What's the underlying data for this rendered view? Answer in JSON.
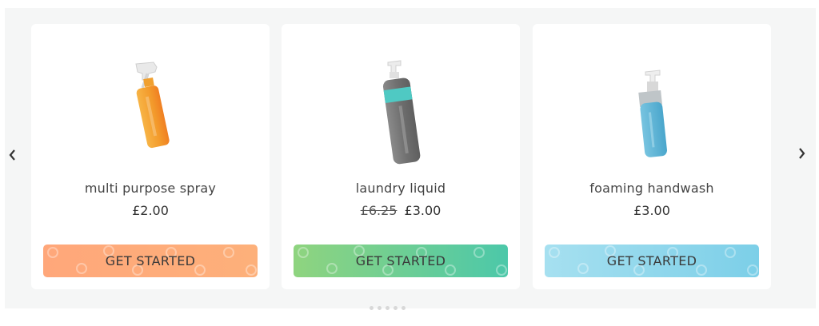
{
  "carousel": {
    "prev_icon": "chevron-left-icon",
    "next_icon": "chevron-right-icon",
    "dot_count": 5
  },
  "products": [
    {
      "name": "multi purpose spray",
      "price": "£2.00",
      "old_price": "",
      "button": "GET STARTED",
      "image_icon": "spray-bottle-icon",
      "color": "#f5a33a"
    },
    {
      "name": "laundry liquid",
      "price": "£3.00",
      "old_price": "£6.25",
      "button": "GET STARTED",
      "image_icon": "pump-bottle-icon",
      "color": "#7a7a7a"
    },
    {
      "name": "foaming handwash",
      "price": "£3.00",
      "old_price": "",
      "button": "GET STARTED",
      "image_icon": "foam-dispenser-icon",
      "color": "#5fb6d6"
    }
  ]
}
